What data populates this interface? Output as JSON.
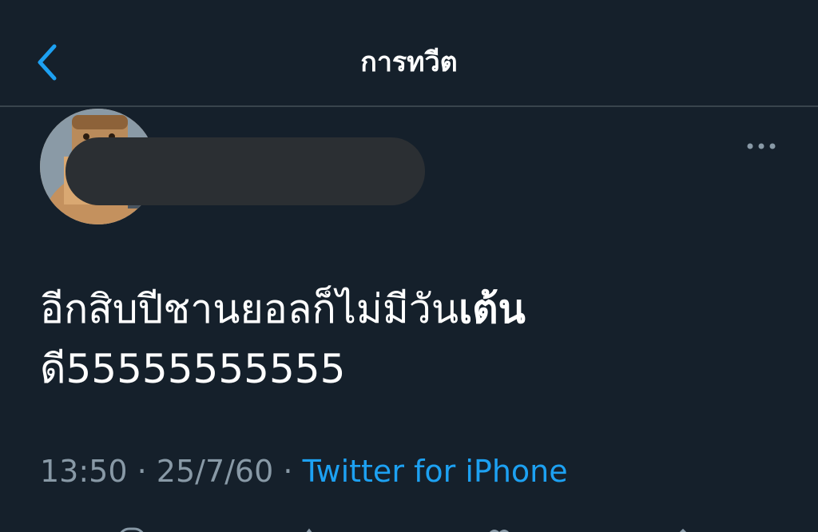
{
  "header": {
    "title": "การทวีต",
    "back_icon": "chevron-left-icon"
  },
  "author": {
    "avatar_icon": "avatar-icon",
    "name_redacted": true,
    "more_icon": "more-horizontal-icon"
  },
  "tweet": {
    "text_regular": "อีกสิบปีชานยอลก็ไม่มีวัน",
    "text_bold": "เต้น",
    "text_line2": "ดี55555555555"
  },
  "meta": {
    "time": "13:50",
    "separator": "·",
    "date": "25/7/60",
    "source": "Twitter for iPhone"
  },
  "colors": {
    "background": "#15202b",
    "accent": "#1da1f2",
    "muted": "#8899a6",
    "divider": "#38444d",
    "redaction": "#2b2f33"
  },
  "actions": {
    "icons": [
      "reply-icon",
      "retweet-icon",
      "like-icon",
      "share-icon"
    ]
  }
}
